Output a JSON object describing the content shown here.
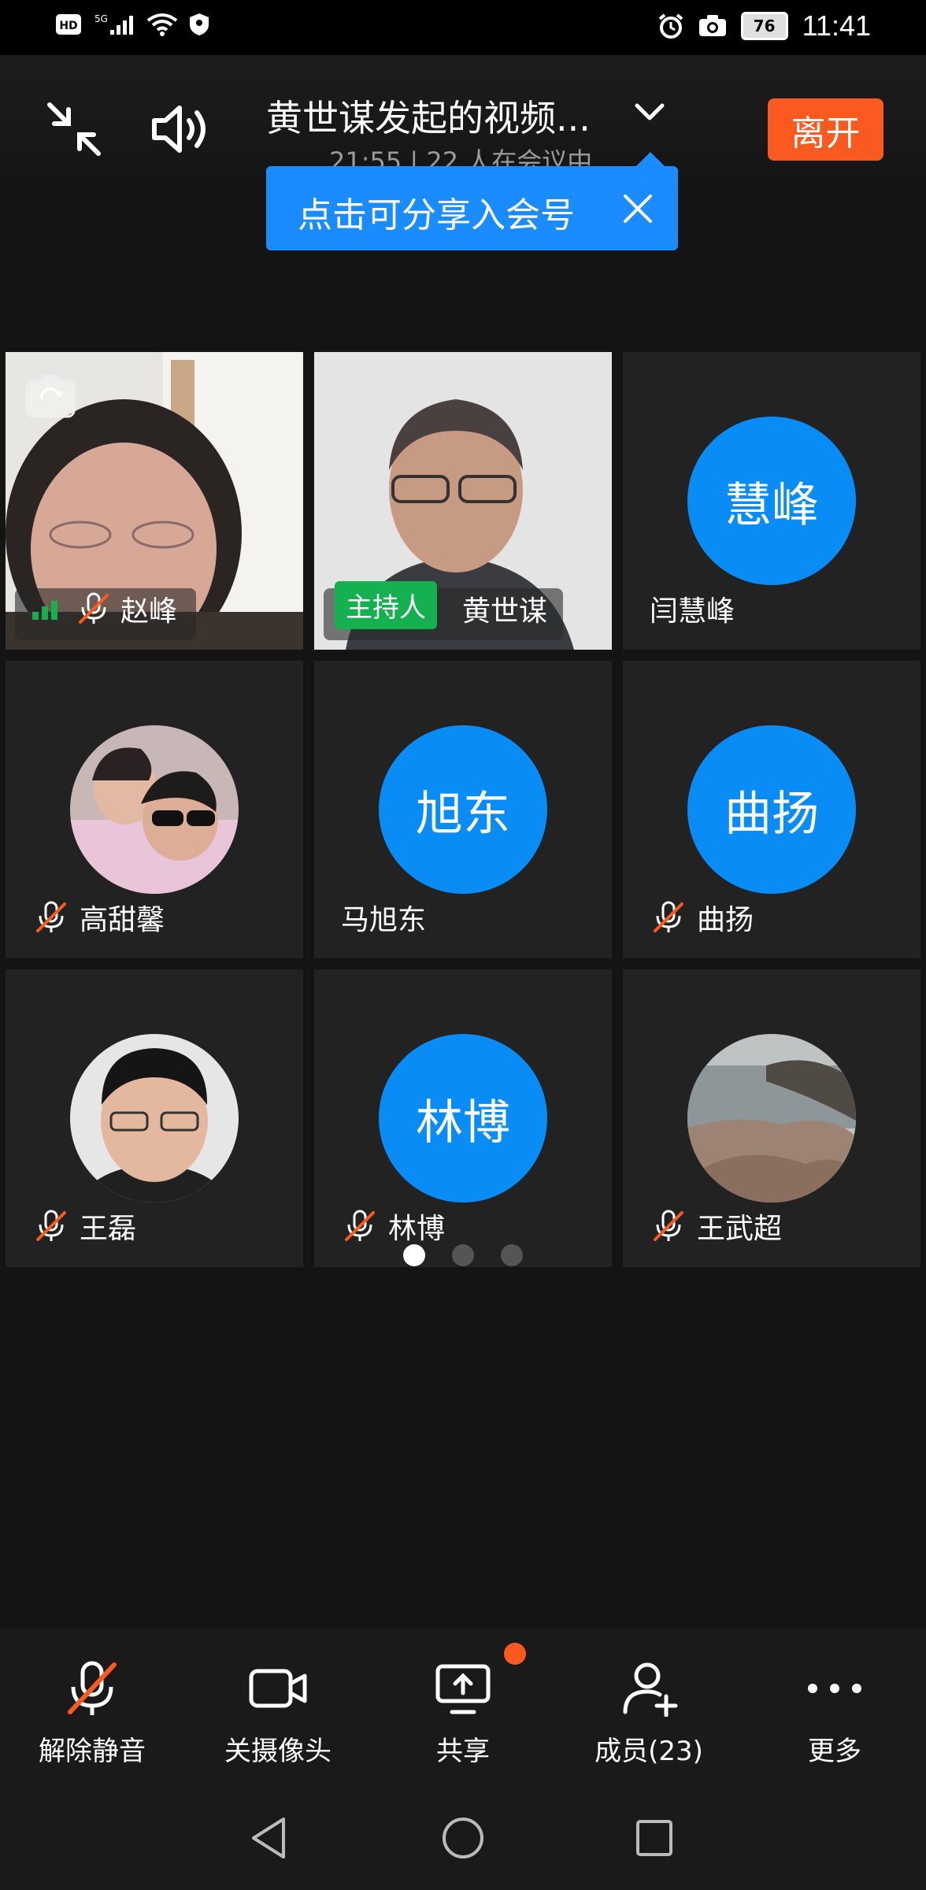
{
  "status_bar": {
    "left_icons": [
      "hd-icon",
      "5g-signal-icon",
      "wifi-icon",
      "vpn-shield-icon"
    ],
    "battery": "76",
    "time": "11:41"
  },
  "header": {
    "title": "黄世谋发起的视频...",
    "subtitle": "21:55 | 22 人在会议中",
    "leave_label": "离开"
  },
  "tooltip": {
    "text": "点击可分享入会号"
  },
  "participants": [
    {
      "name": "赵峰",
      "type": "video",
      "muted": true
    },
    {
      "name": "黄世谋",
      "type": "video",
      "host_label": "主持人",
      "muted": false
    },
    {
      "name": "闫慧峰",
      "type": "initials",
      "initials": "慧峰",
      "muted": false
    },
    {
      "name": "高甜馨",
      "type": "photo",
      "muted": true
    },
    {
      "name": "马旭东",
      "type": "initials",
      "initials": "旭东",
      "muted": false
    },
    {
      "name": "曲扬",
      "type": "initials",
      "initials": "曲扬",
      "muted": true
    },
    {
      "name": "王磊",
      "type": "photo",
      "muted": true
    },
    {
      "name": "林博",
      "type": "initials",
      "initials": "林博",
      "muted": true
    },
    {
      "name": "王武超",
      "type": "photo",
      "muted": true
    }
  ],
  "pagination": {
    "pages": 3,
    "current": 1
  },
  "toolbar": {
    "unmute_label": "解除静音",
    "camera_label": "关摄像头",
    "share_label": "共享",
    "members_label": "成员(23)",
    "more_label": "更多"
  },
  "colors": {
    "accent_blue": "#1a8cff",
    "leave_orange": "#fa5a20",
    "host_green": "#15b050",
    "mute_red": "#fa5a20"
  }
}
